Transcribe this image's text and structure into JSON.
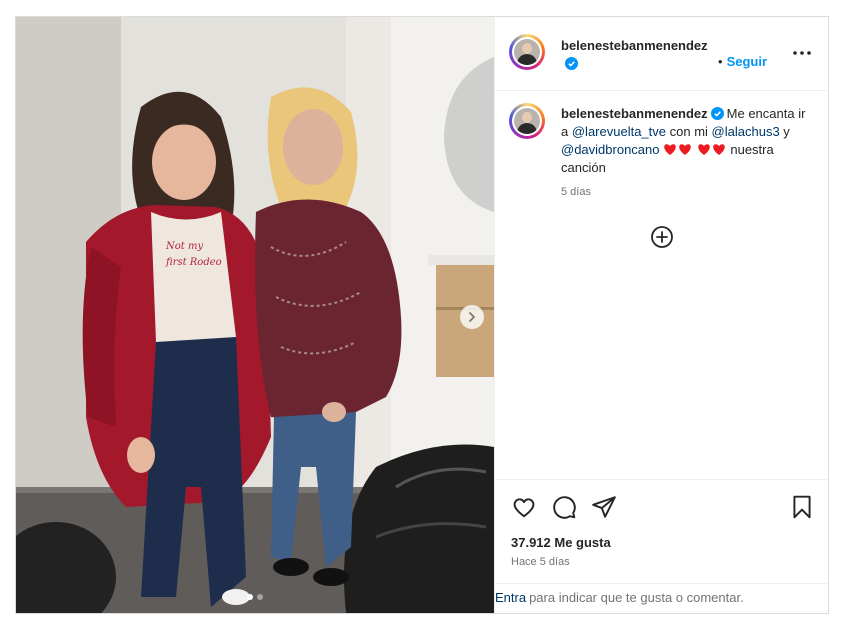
{
  "post": {
    "username": "belenestebanmenendez",
    "follow_separator": "•",
    "follow_label": "Seguir",
    "caption": {
      "username": "belenestebanmenendez",
      "part1": "Me encanta ir a",
      "mention1": "@larevuelta_tve",
      "part2": "con mi",
      "mention2": "@lalachus3",
      "part3": "y",
      "mention3": "@davidbroncano",
      "part4": "nuestra canción"
    },
    "time_ago": "5 días",
    "likes": "37.912 Me gusta",
    "posted": "Hace 5 días",
    "comment_bar": {
      "link": "Entra",
      "text": "para indicar que te gusta o comentar."
    },
    "carousel": {
      "count": 2,
      "active": 1
    },
    "colors": {
      "accent": "#0095f6",
      "mention": "#00376b",
      "heart": "#ed1c24",
      "muted": "#737373"
    },
    "icons": [
      "verified-icon",
      "more-icon",
      "heart-emoji-icon",
      "plus-circle-icon",
      "like-icon",
      "comment-icon",
      "share-icon",
      "save-icon",
      "chevron-right-icon"
    ]
  }
}
